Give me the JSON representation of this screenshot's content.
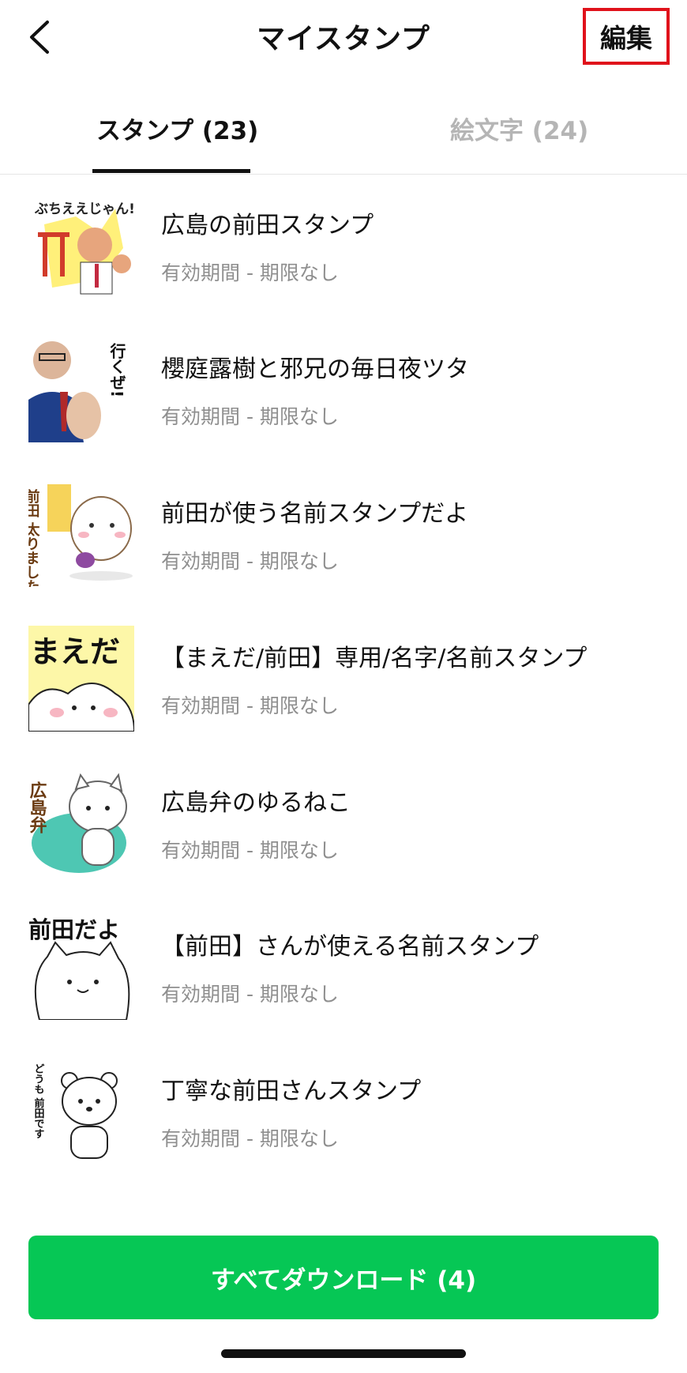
{
  "header": {
    "title": "マイスタンプ",
    "edit_label": "編集",
    "back_icon": "chevron-left-icon"
  },
  "tabs": [
    {
      "label": "スタンプ (23)",
      "active": true
    },
    {
      "label": "絵文字 (24)",
      "active": false
    }
  ],
  "stickers": [
    {
      "title": "広島の前田スタンプ",
      "subtitle": "有効期間 - 期限なし",
      "thumb_text": "ぶちええじゃん!"
    },
    {
      "title": "櫻庭露樹と邪兄の毎日夜ツタ",
      "subtitle": "有効期間 - 期限なし",
      "thumb_text": "行くぜ!"
    },
    {
      "title": "前田が使う名前スタンプだよ",
      "subtitle": "有効期間 - 期限なし",
      "thumb_text": "前田 太りました"
    },
    {
      "title": "【まえだ/前田】専用/名字/名前スタンプ",
      "subtitle": "有効期間 - 期限なし",
      "thumb_text": "まえだ"
    },
    {
      "title": "広島弁のゆるねこ",
      "subtitle": "有効期間 - 期限なし",
      "thumb_text": "広島弁"
    },
    {
      "title": "【前田】さんが使える名前スタンプ",
      "subtitle": "有効期間 - 期限なし",
      "thumb_text": "前田だよ"
    },
    {
      "title": "丁寧な前田さんスタンプ",
      "subtitle": "有効期間 - 期限なし",
      "thumb_text": "どうも 前田です"
    }
  ],
  "download_all_label": "すべてダウンロード (4)",
  "colors": {
    "accent_green": "#06c755",
    "highlight_red": "#e0121b",
    "subtitle_gray": "#8f8f8f",
    "inactive_tab_gray": "#b5b5b5"
  }
}
